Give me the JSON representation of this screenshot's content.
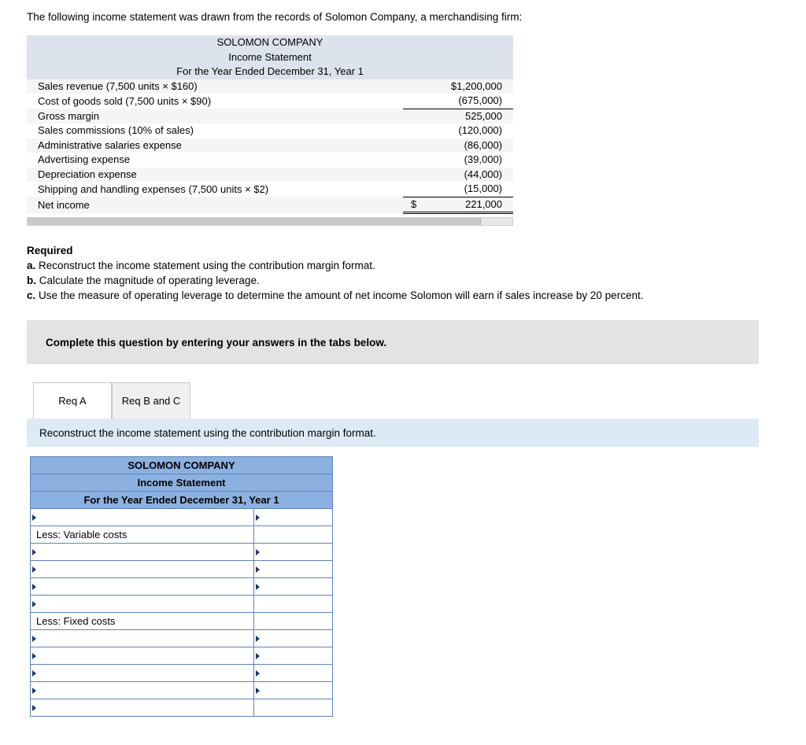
{
  "intro": "The following income statement was drawn from the records of Solomon Company, a merchandising firm:",
  "given_statement": {
    "header": [
      "SOLOMON COMPANY",
      "Income Statement",
      "For the Year Ended December 31, Year 1"
    ],
    "rows": [
      {
        "label": "Sales revenue (7,500 units × $160)",
        "value": "$1,200,000",
        "rule": "none"
      },
      {
        "label": "Cost of goods sold (7,500 units × $90)",
        "value": "(675,000)",
        "rule": "single"
      },
      {
        "label": "Gross margin",
        "value": "525,000",
        "rule": "none"
      },
      {
        "label": "Sales commissions (10% of sales)",
        "value": "(120,000)",
        "rule": "none"
      },
      {
        "label": "Administrative salaries expense",
        "value": "(86,000)",
        "rule": "none"
      },
      {
        "label": "Advertising expense",
        "value": "(39,000)",
        "rule": "none"
      },
      {
        "label": "Depreciation expense",
        "value": "(44,000)",
        "rule": "none"
      },
      {
        "label": "Shipping and handling expenses (7,500 units × $2)",
        "value": "(15,000)",
        "rule": "single"
      }
    ],
    "net_row": {
      "label": "Net income",
      "dollar": "$",
      "value": "221,000"
    }
  },
  "required": {
    "title": "Required",
    "items": [
      {
        "marker": "a.",
        "text": "Reconstruct the income statement using the contribution margin format."
      },
      {
        "marker": "b.",
        "text": "Calculate the magnitude of operating leverage."
      },
      {
        "marker": "c.",
        "text": "Use the measure of operating leverage to determine the amount of net income Solomon will earn if sales increase by 20 percent."
      }
    ]
  },
  "instruction_bar": "Complete this question by entering your answers in the tabs below.",
  "tabs": [
    {
      "label": "Req A",
      "active": true
    },
    {
      "label": "Req B and C",
      "active": false
    }
  ],
  "prompt": "Reconstruct the income statement using the contribution margin format.",
  "answer_table": {
    "header": [
      "SOLOMON COMPANY",
      "Income Statement",
      "For the Year Ended December 31, Year 1"
    ],
    "rows": [
      {
        "label": "",
        "value": "",
        "label_dropdown": true,
        "value_dropdown": true,
        "final": false
      },
      {
        "label": "Less: Variable costs",
        "value": "",
        "label_dropdown": false,
        "value_dropdown": false,
        "final": false
      },
      {
        "label": "",
        "value": "",
        "label_dropdown": true,
        "value_dropdown": true,
        "final": false
      },
      {
        "label": "",
        "value": "",
        "label_dropdown": true,
        "value_dropdown": true,
        "final": false
      },
      {
        "label": "",
        "value": "",
        "label_dropdown": true,
        "value_dropdown": true,
        "final": false
      },
      {
        "label": "",
        "value": "",
        "label_dropdown": true,
        "value_dropdown": false,
        "final": false
      },
      {
        "label": "Less: Fixed costs",
        "value": "",
        "label_dropdown": false,
        "value_dropdown": false,
        "final": false
      },
      {
        "label": "",
        "value": "",
        "label_dropdown": true,
        "value_dropdown": true,
        "final": false
      },
      {
        "label": "",
        "value": "",
        "label_dropdown": true,
        "value_dropdown": true,
        "final": false
      },
      {
        "label": "",
        "value": "",
        "label_dropdown": true,
        "value_dropdown": true,
        "final": false
      },
      {
        "label": "",
        "value": "",
        "label_dropdown": true,
        "value_dropdown": true,
        "final": false
      },
      {
        "label": "",
        "value": "",
        "label_dropdown": true,
        "value_dropdown": false,
        "final": true
      }
    ]
  }
}
